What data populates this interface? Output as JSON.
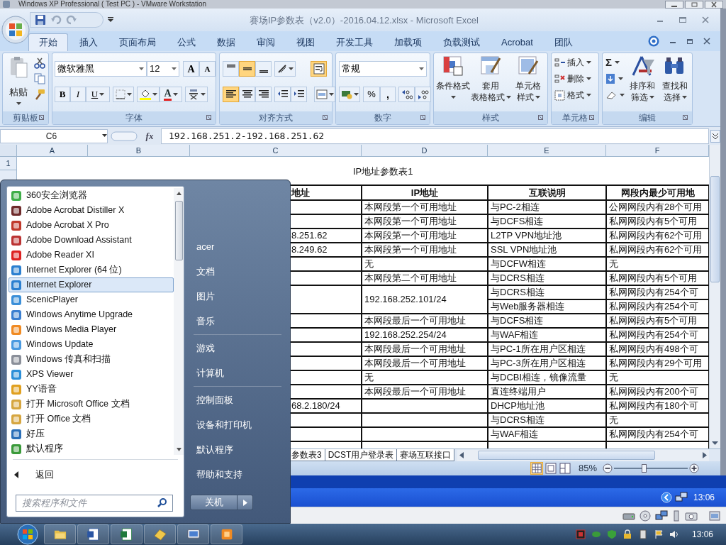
{
  "vm_window": {
    "title": "Windows XP Professional ( Test PC ) - VMware Workstation"
  },
  "excel": {
    "title": "赛场IP参数表（v2.0）-2016.04.12.xlsx - Microsoft Excel",
    "tabs": [
      {
        "label": "开始",
        "selected": true
      },
      {
        "label": "插入",
        "selected": false
      },
      {
        "label": "页面布局",
        "selected": false
      },
      {
        "label": "公式",
        "selected": false
      },
      {
        "label": "数据",
        "selected": false
      },
      {
        "label": "审阅",
        "selected": false
      },
      {
        "label": "视图",
        "selected": false
      },
      {
        "label": "开发工具",
        "selected": false
      },
      {
        "label": "加载项",
        "selected": false
      },
      {
        "label": "负载测试",
        "selected": false
      },
      {
        "label": "Acrobat",
        "selected": false
      },
      {
        "label": "团队",
        "selected": false
      }
    ],
    "ribbon": {
      "clipboard": {
        "label": "剪贴板",
        "paste": "粘贴"
      },
      "font": {
        "label": "字体",
        "name": "微软雅黑",
        "size": "12",
        "grow_shrink": [
          "A",
          "A"
        ],
        "styles": [
          "B",
          "I",
          "U"
        ],
        "color_letter": "A"
      },
      "alignment": {
        "label": "对齐方式",
        "vertical": [
          {
            "selected": false
          },
          {
            "selected": true
          },
          {
            "selected": false
          }
        ],
        "horizontal": [
          {
            "selected": true
          },
          {
            "selected": false
          },
          {
            "selected": false
          }
        ],
        "wrap_text": {
          "selected": true
        }
      },
      "number": {
        "label": "数字",
        "format": "常规",
        "symbols": [
          "%",
          ","
        ]
      },
      "styles": {
        "label": "样式",
        "buttons": [
          {
            "lines": [
              "条件格式"
            ]
          },
          {
            "lines": [
              "套用",
              "表格格式"
            ]
          },
          {
            "lines": [
              "单元格",
              "样式"
            ]
          }
        ]
      },
      "cells": {
        "label": "单元格",
        "buttons": [
          "插入",
          "删除",
          "格式"
        ]
      },
      "editing": {
        "label": "编辑",
        "sum": "Σ",
        "buttons": [
          {
            "lines": [
              "排序和",
              "筛选"
            ]
          },
          {
            "lines": [
              "查找和",
              "选择"
            ]
          }
        ]
      }
    },
    "formula_bar": {
      "cell": "C6",
      "function_label": "fx",
      "formula": "192.168.251.2-192.168.251.62"
    },
    "sheet": {
      "columns": [
        "A",
        "B",
        "C",
        "D",
        "E",
        "F"
      ],
      "row_numbers": [
        "1"
      ],
      "title": "IP地址参数表1",
      "header": [
        "地址",
        "IP地址",
        "互联说明",
        "网段内最少可用地"
      ],
      "rows": [
        {
          "ip": "本网段第一个可用地址",
          "links": [
            [
              "与PC-2相连",
              "公网网段内有28个可用"
            ]
          ]
        },
        {
          "ip": "本网段第一个可用地址",
          "links": [
            [
              "与DCFS相连",
              "私网网段内有5个可用"
            ]
          ]
        },
        {
          "address": "8.251.62",
          "ip": "本网段第一个可用地址",
          "links": [
            [
              "L2TP VPN地址池",
              "私网网段内有62个可用"
            ]
          ]
        },
        {
          "address": "8.249.62",
          "ip": "本网段第一个可用地址",
          "links": [
            [
              "SSL VPN地址池",
              "私网网段内有62个可用"
            ]
          ]
        },
        {
          "ip": "无",
          "links": [
            [
              "与DCFW相连",
              "无"
            ]
          ]
        },
        {
          "ip": "本网段第二个可用地址",
          "links": [
            [
              "与DCRS相连",
              "私网网段内有5个可用"
            ]
          ]
        },
        {
          "ip": "192.168.252.101/24",
          "links": [
            [
              "与DCRS相连",
              "私网网段内有254个可"
            ],
            [
              "与Web服务器相连",
              "私网网段内有254个可"
            ]
          ]
        },
        {
          "ip": "本网段最后一个可用地址",
          "links": [
            [
              "与DCFS相连",
              "私网网段内有5个可用"
            ]
          ]
        },
        {
          "ip": "192.168.252.254/24",
          "links": [
            [
              "与WAF相连",
              "私网网段内有254个可"
            ]
          ]
        },
        {
          "ip": "本网段最后一个可用地址",
          "links": [
            [
              "与PC-1所在用户区相连",
              "私网网段内有498个可"
            ]
          ]
        },
        {
          "ip": "本网段最后一个可用地址",
          "links": [
            [
              "与PC-3所在用户区相连",
              "私网网段内有29个可用"
            ]
          ]
        },
        {
          "ip": "无",
          "links": [
            [
              "与DCBI相连，镜像流量",
              "无"
            ]
          ]
        },
        {
          "ip": "本网段最后一个可用地址",
          "links": [
            [
              "直连终端用户",
              "私网网段内有200个可"
            ]
          ]
        },
        {
          "address": "68.2.180/24",
          "links": [
            [
              "DHCP地址池",
              "私网网段内有180个可"
            ]
          ]
        },
        {
          "links": [
            [
              "与DCRS相连",
              "无"
            ]
          ]
        },
        {
          "links": [
            [
              "与WAF相连",
              "私网网段内有254个可"
            ]
          ]
        }
      ],
      "sheet_tabs": [
        "参数表3",
        "DCST用户登录表",
        "赛场互联接口"
      ]
    },
    "status_bar": {
      "views": [
        {
          "selected": true
        },
        {
          "selected": false
        },
        {
          "selected": false
        }
      ],
      "zoom": "85%",
      "zoom_slider": {
        "level": 0.4
      }
    }
  },
  "guest_taskbar": {
    "clock": "13:06"
  },
  "start_menu": {
    "programs": [
      {
        "label": "360安全浏览器",
        "selected": false
      },
      {
        "label": "Adobe Acrobat Distiller X",
        "selected": false
      },
      {
        "label": "Adobe Acrobat X Pro",
        "selected": false
      },
      {
        "label": "Adobe Download Assistant",
        "selected": false
      },
      {
        "label": "Adobe Reader XI",
        "selected": false
      },
      {
        "label": "Internet Explorer (64 位)",
        "selected": false
      },
      {
        "label": "Internet Explorer",
        "selected": true
      },
      {
        "label": "ScenicPlayer",
        "selected": false
      },
      {
        "label": "Windows Anytime Upgrade",
        "selected": false
      },
      {
        "label": "Windows Media Player",
        "selected": false
      },
      {
        "label": "Windows Update",
        "selected": false
      },
      {
        "label": "Windows 传真和扫描",
        "selected": false
      },
      {
        "label": "XPS Viewer",
        "selected": false
      },
      {
        "label": "YY语音",
        "selected": false
      },
      {
        "label": "打开 Microsoft Office 文档",
        "selected": false
      },
      {
        "label": "打开 Office 文档",
        "selected": false
      },
      {
        "label": "好压",
        "selected": false
      },
      {
        "label": "默认程序",
        "selected": false
      }
    ],
    "back": "返回",
    "search": {
      "placeholder": "搜索程序和文件"
    },
    "places": [
      [
        "acer",
        "文档",
        "图片",
        "音乐"
      ],
      [
        "游戏",
        "计算机"
      ],
      [
        "控制面板",
        "设备和打印机",
        "默认程序",
        "帮助和支持"
      ]
    ],
    "shutdown": "关机"
  },
  "host_taskbar": {
    "clock": "13:06"
  }
}
